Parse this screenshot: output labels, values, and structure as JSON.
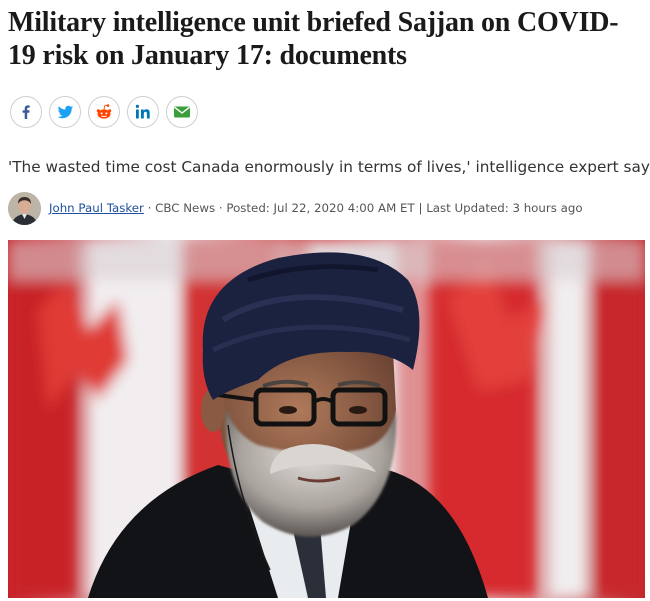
{
  "article": {
    "headline": "Military intelligence unit briefed Sajjan on COVID-19 risk on January 17: documents",
    "deck": "'The wasted time cost Canada enormously in terms of lives,' intelligence expert says"
  },
  "share": {
    "buttons": [
      {
        "name": "facebook",
        "icon": "facebook-icon",
        "color": "#3b5998"
      },
      {
        "name": "twitter",
        "icon": "twitter-icon",
        "color": "#1da1f2"
      },
      {
        "name": "reddit",
        "icon": "reddit-icon",
        "color": "#ff4500"
      },
      {
        "name": "linkedin",
        "icon": "linkedin-icon",
        "color": "#0077b5"
      },
      {
        "name": "email",
        "icon": "email-icon",
        "color": "#3a9e3a"
      }
    ]
  },
  "byline": {
    "author": "John Paul Tasker",
    "source": "CBC News",
    "posted": "Posted: Jul 22, 2020 4:00 AM ET",
    "updated": "Last Updated: 3 hours ago",
    "sep_dot": " · ",
    "sep_bar": " | "
  },
  "photo": {
    "subject": "man in navy turban and glasses with grey beard in front of Canadian flags",
    "colors": {
      "flag_red": "#d52b1e",
      "flag_white": "#f3f1f2",
      "turban": "#1a2240"
    }
  }
}
